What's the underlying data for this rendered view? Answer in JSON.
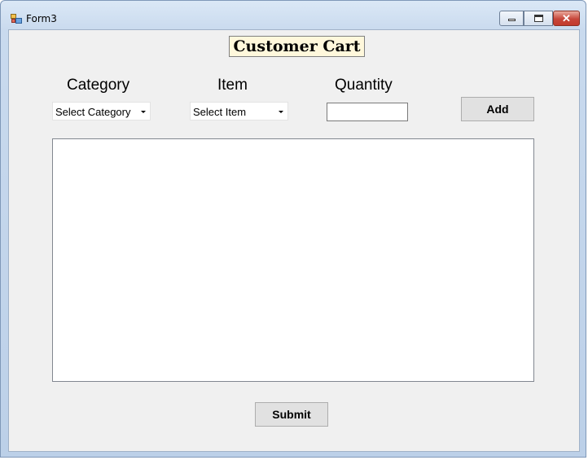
{
  "window": {
    "title": "Form3",
    "icons": [
      "app-icon",
      "minimize-icon",
      "maximize-icon",
      "close-icon"
    ]
  },
  "form": {
    "heading": "Customer Cart",
    "heading_bg": "#fff8dc",
    "category": {
      "label": "Category",
      "selected": "Select Category"
    },
    "item": {
      "label": "Item",
      "selected": "Select Item"
    },
    "quantity": {
      "label": "Quantity",
      "value": ""
    },
    "add_button": "Add",
    "cart_items": [],
    "submit_button": "Submit"
  }
}
